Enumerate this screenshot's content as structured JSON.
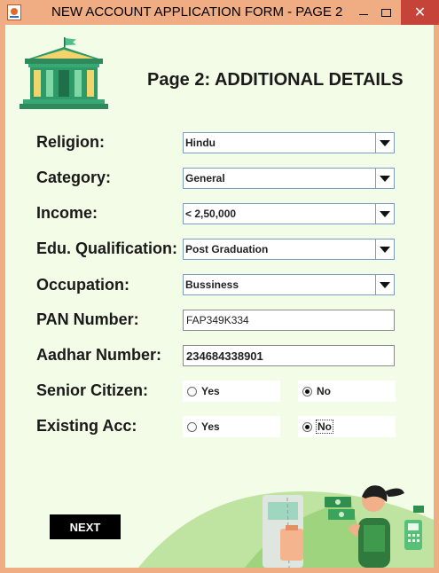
{
  "window": {
    "title": "NEW ACCOUNT APPLICATION FORM - PAGE 2",
    "close_glyph": "✕"
  },
  "page": {
    "heading": "Page 2: ADDITIONAL DETAILS"
  },
  "form": {
    "religion": {
      "label": "Religion:",
      "value": "Hindu"
    },
    "category": {
      "label": "Category:",
      "value": "General"
    },
    "income": {
      "label": "Income:",
      "value": "< 2,50,000"
    },
    "education": {
      "label": "Edu. Qualification:",
      "value": "Post Graduation"
    },
    "occupation": {
      "label": "Occupation:",
      "value": "Bussiness"
    },
    "pan": {
      "label": "PAN Number:",
      "value": "FAP349K334"
    },
    "aadhar": {
      "label": "Aadhar Number:",
      "value": "234684338901"
    },
    "senior_citizen": {
      "label": "Senior Citizen:",
      "yes_label": "Yes",
      "no_label": "No",
      "selected": "No"
    },
    "existing_account": {
      "label": "Existing Acc:",
      "yes_label": "Yes",
      "no_label": "No",
      "selected": "No"
    }
  },
  "actions": {
    "next_label": "NEXT"
  },
  "icons": {
    "app": "java-app-icon",
    "minimize": "minimize-icon",
    "maximize": "maximize-icon",
    "close": "close-icon",
    "logo": "bank-building-icon",
    "dropdown": "chevron-down-icon"
  },
  "colors": {
    "titlebar": "#f0ad83",
    "background": "#f2fce6",
    "close_button": "#c6433a",
    "next_button": "#000000",
    "logo_green": "#2e9a68"
  }
}
